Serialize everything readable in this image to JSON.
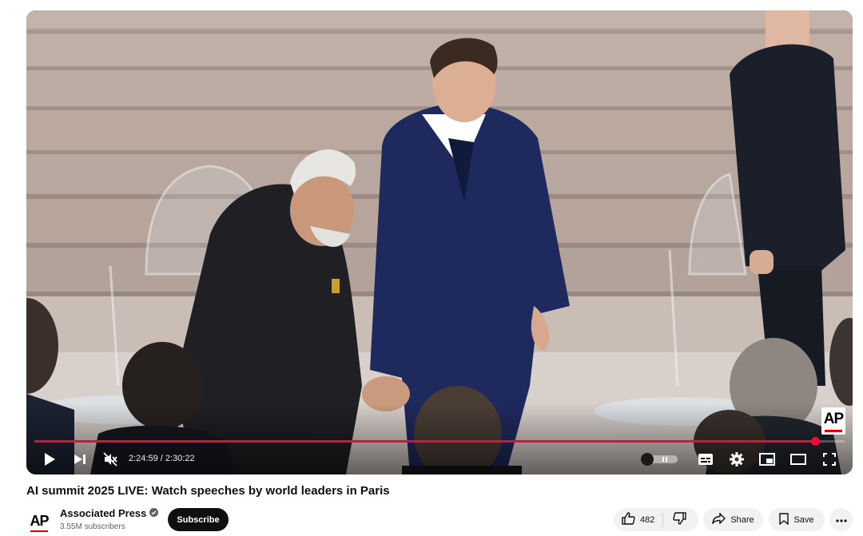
{
  "player": {
    "current_time": "2:24:59",
    "duration": "2:30:22",
    "time_display": "2:24:59 / 2:30:22",
    "progress_fraction": 0.964,
    "watermark": "AP",
    "accent_color": "#ff0033",
    "icons": {
      "play": "play-icon",
      "next": "next-icon",
      "volume": "volume-muted-icon",
      "autoplay": "autoplay-toggle-icon",
      "captions": "captions-icon",
      "settings": "gear-icon",
      "miniplayer": "miniplayer-icon",
      "theater": "theater-mode-icon",
      "fullscreen": "fullscreen-icon"
    }
  },
  "video": {
    "title": "AI summit 2025 LIVE: Watch speeches by world leaders in Paris"
  },
  "channel": {
    "logo_text": "AP",
    "name": "Associated Press",
    "verified": true,
    "subscribers": "3.55M subscribers",
    "subscribe_label": "Subscribe"
  },
  "actions": {
    "like_count": "482",
    "share_label": "Share",
    "save_label": "Save",
    "icons": {
      "like": "thumbs-up-icon",
      "dislike": "thumbs-down-icon",
      "share": "share-arrow-icon",
      "save": "bookmark-icon",
      "more": "more-horizontal-icon"
    }
  }
}
